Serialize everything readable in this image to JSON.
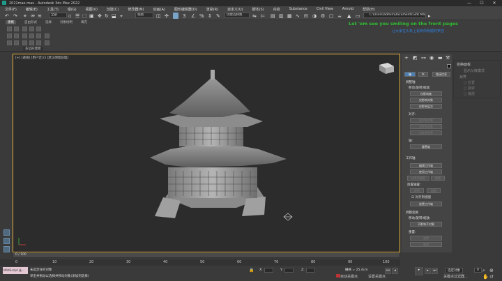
{
  "window": {
    "title": "2022max.max - Autodesk 3ds Max 2022",
    "minimize": "—",
    "maximize": "☐",
    "close": "✕"
  },
  "menu": [
    "文件(F)",
    "编辑(E)",
    "工具(T)",
    "组(G)",
    "视图(V)",
    "创建(C)",
    "修改器(M)",
    "动画(A)",
    "图形编辑器(D)",
    "渲染(R)",
    "自定义(U)",
    "脚本(S)",
    "内容",
    "Substance",
    "Civil View",
    "Arnold",
    "帮助(H)"
  ],
  "toolbar": {
    "filter": "全部",
    "ref_coord": "视图",
    "selection_set": "创建选择集",
    "path": "C:\\Users\\admin\\Documents\\3ds Max 2022"
  },
  "ribbon": {
    "tabs": [
      "建模",
      "自由形式",
      "选择",
      "对象绘制",
      "填充"
    ],
    "poly_mode": "多边形建模"
  },
  "overlay": {
    "line1": "Let 'em see you smiling on the front pages",
    "line2": "让大家在头条上看到你明媚的笑容"
  },
  "viewport": {
    "label": "[+] [透视] [用户定义] [默认明暗处理]"
  },
  "command_panel": {
    "tabs": [
      "轴",
      "IK",
      "链接信息"
    ],
    "adjust": {
      "title": "调整轴",
      "move_label": "移动/旋转/缩放:",
      "b1": "仅影响轴",
      "b2": "仅影响对象",
      "b3": "仅影响层次",
      "align_label": "对齐:",
      "b4": "居中到对象",
      "b5": "对齐到对象",
      "b6": "对齐到世界",
      "axis_label": "轴:",
      "b7": "重置轴"
    },
    "work": {
      "title": "工作轴",
      "b1": "编辑工作轴",
      "b2": "使用工作轴",
      "b3": "对齐到视图",
      "b4": "重置",
      "place_label": "放置轴置：",
      "b5": "视图",
      "b6": "曲面",
      "check": "对齐到视图",
      "b7": "放置工作轴"
    },
    "transform": {
      "title": "调整变换",
      "move_label": "移动/旋转/缩放:",
      "b1": "不影响子对象",
      "reset_label": "重置:",
      "b2": "变换",
      "b3": "缩放"
    }
  },
  "right_panel": {
    "title": "变换面板",
    "item": "显示父级模式",
    "sub": "对齐",
    "r1": "位置",
    "r2": "旋转",
    "r3": "缩放"
  },
  "timeline": {
    "frame": "0 / 100",
    "ticks": [
      "0",
      "10",
      "20",
      "30",
      "40",
      "50",
      "60",
      "70",
      "80",
      "90",
      "100"
    ]
  },
  "status": {
    "maxscript": "MAXScript 迷...",
    "line1": "未选定任何对象",
    "line2": "单击并拖动以选择并移动对象(添加到选择)",
    "x": "X:",
    "y": "Y:",
    "z": "Z:",
    "grid": "栅格 = 25.4cm",
    "autokey": "自动关键点",
    "setkey": "设置关键点",
    "keyfilter": "关键点过滤器...",
    "selected": "选定对象",
    "frame": "0"
  }
}
